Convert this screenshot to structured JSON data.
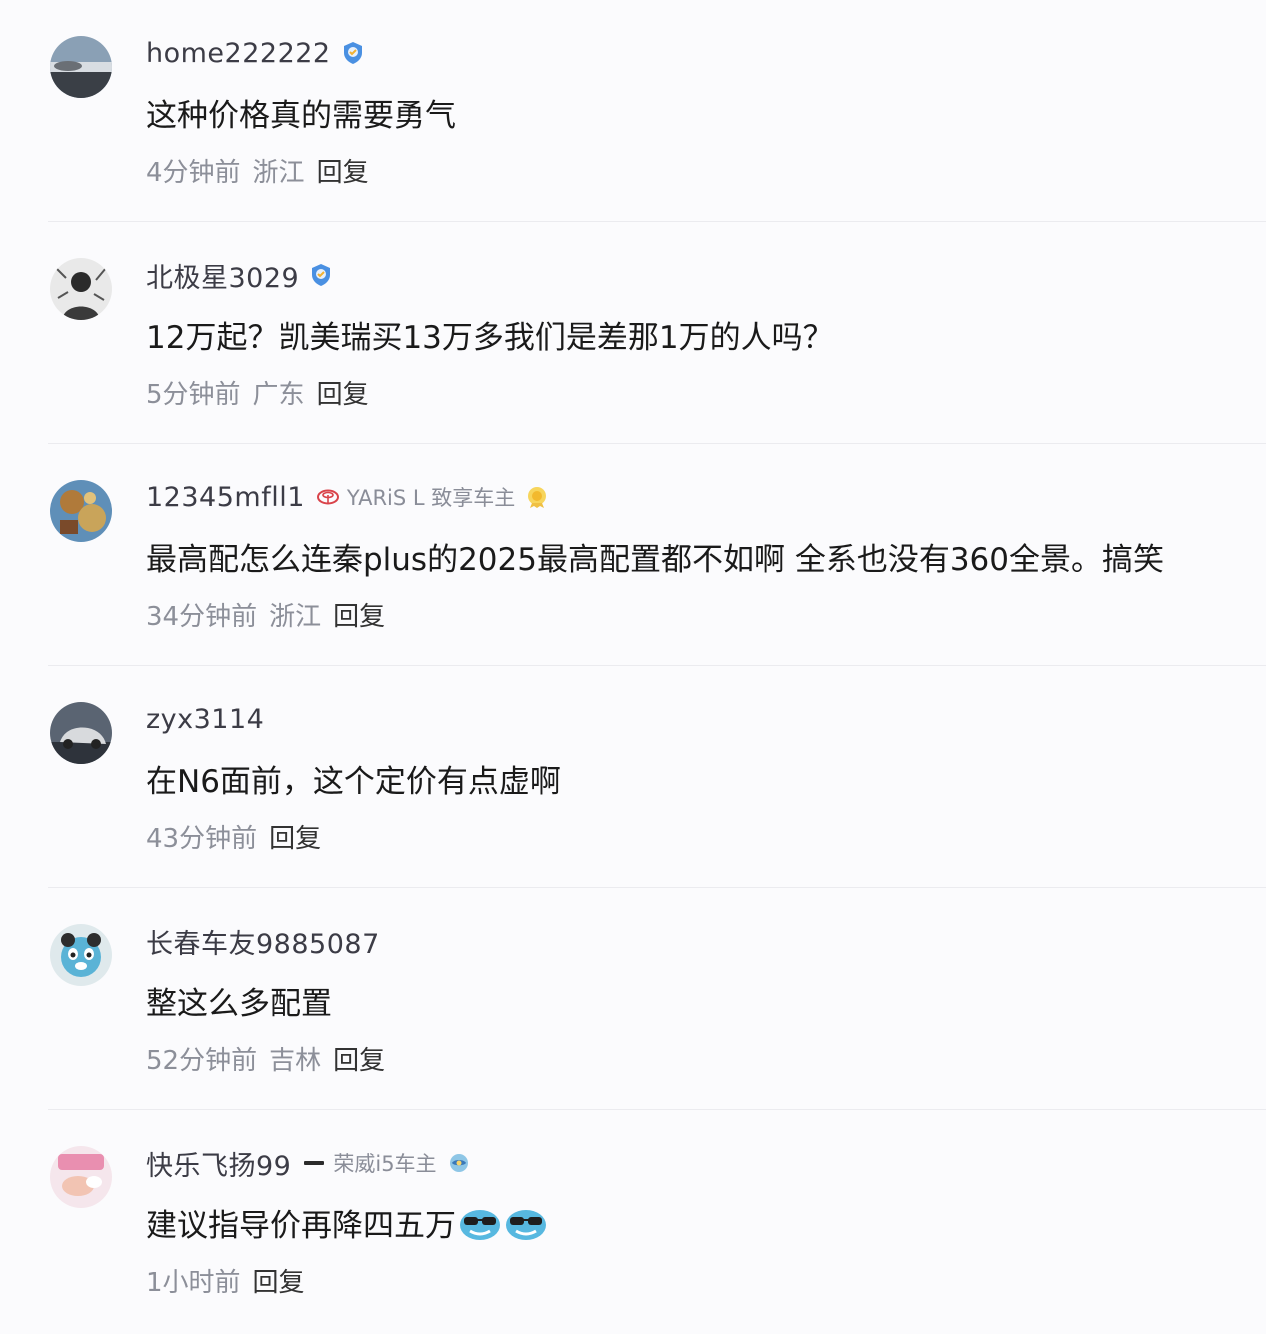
{
  "comments": [
    {
      "username": "home222222",
      "verified": true,
      "text": "这种价格真的需要勇气",
      "time": "4分钟前",
      "location": "浙江",
      "reply": "回复",
      "avatar_icon": "landscape-avatar"
    },
    {
      "username": "北极星3029",
      "verified": true,
      "text": "12万起？凯美瑞买13万多我们是差那1万的人吗？",
      "time": "5分钟前",
      "location": "广东",
      "reply": "回复",
      "avatar_icon": "sketch-portrait-avatar"
    },
    {
      "username": "12345mfll1",
      "verified": false,
      "car_badge": "YARiS L 致享车主",
      "car_logo_icon": "toyota-logo-icon",
      "medal_icon": "gold-medal-icon",
      "text": "最高配怎么连秦plus的2025最高配置都不如啊 全系也没有360全景。搞笑",
      "time": "34分钟前",
      "location": "浙江",
      "reply": "回复",
      "avatar_icon": "painting-avatar"
    },
    {
      "username": "zyx3114",
      "verified": false,
      "text": "在N6面前，这个定价有点虚啊",
      "time": "43分钟前",
      "location": "",
      "reply": "回复",
      "avatar_icon": "car-photo-avatar"
    },
    {
      "username": "长春车友9885087",
      "verified": false,
      "text": "整这么多配置",
      "time": "52分钟前",
      "location": "吉林",
      "reply": "回复",
      "avatar_icon": "cartoon-panda-avatar"
    },
    {
      "username": "快乐飞扬99",
      "verified": false,
      "car_badge": "荣威i5车主",
      "car_logo_icon": "roewe-logo-icon",
      "medal_icon": "blue-medal-icon",
      "text": "建议指导价再降四五万",
      "emojis": [
        "sunglasses-emoji-icon",
        "sunglasses-emoji-icon"
      ],
      "time": "1小时前",
      "location": "",
      "reply": "回复",
      "avatar_icon": "pink-photo-avatar"
    }
  ],
  "colors": {
    "background": "#fbfbfd",
    "username": "#3c3c46",
    "meta": "#8c8f99",
    "divider": "#ebebef",
    "verified_badge": "#4a90e2"
  }
}
